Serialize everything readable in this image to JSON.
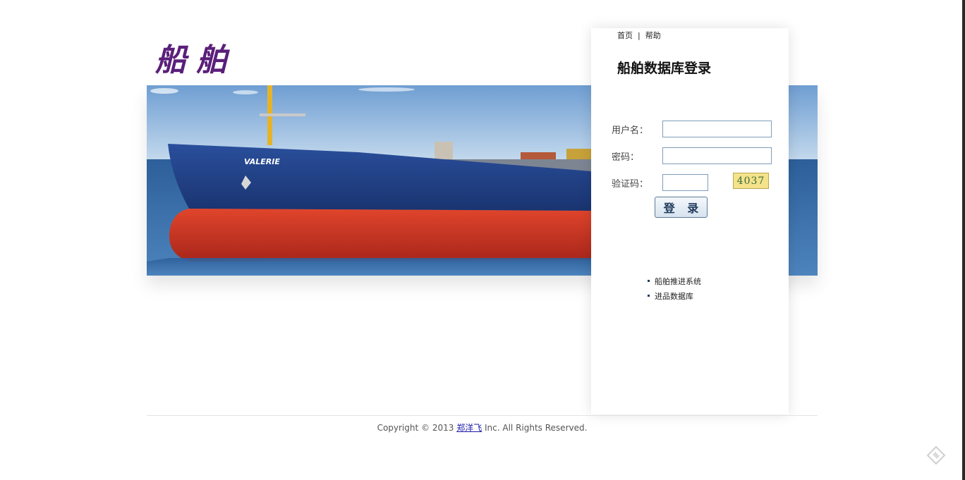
{
  "logo": {
    "text": "船舶"
  },
  "nav": {
    "home": "首页",
    "separator": "|",
    "help": "帮助"
  },
  "login": {
    "title": "船舶数据库登录",
    "username_label": "用户名：",
    "password_label": "密码：",
    "captcha_label": "验证码：",
    "captcha_text": "4037",
    "submit_label": "登 录"
  },
  "links": [
    {
      "label": "船舶推进系统"
    },
    {
      "label": "进品数据库"
    }
  ],
  "banner": {
    "ship_name": "VALERIE"
  },
  "footer": {
    "prefix": "Copyright © 2013 ",
    "author": "郑洋飞",
    "suffix": " Inc. All Rights Reserved."
  },
  "icons": {
    "corner": "tag-icon"
  },
  "colors": {
    "logo": "#5a1f7a",
    "hull_red": "#c9331f",
    "hull_blue": "#1f3f86",
    "sea": "#3467a4"
  }
}
